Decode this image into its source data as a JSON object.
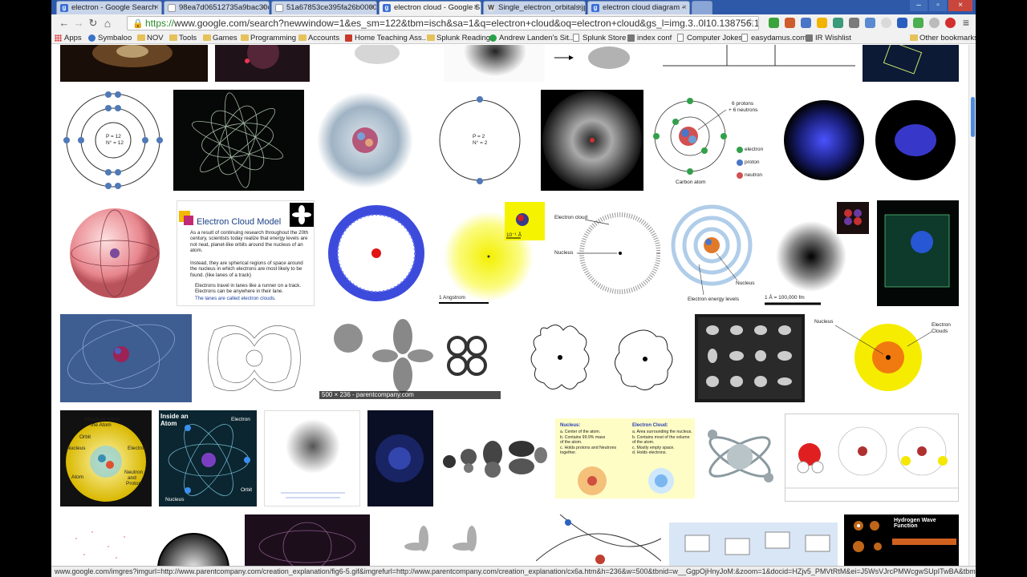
{
  "tabs": [
    {
      "label": "electron - Google Search",
      "icon": "google-icon"
    },
    {
      "label": "98ea7d06512735a9bac30c",
      "icon": "document-icon"
    },
    {
      "label": "51a67853ce395fa26b00000",
      "icon": "document-icon"
    },
    {
      "label": "electron cloud - Google S",
      "icon": "google-icon",
      "active": true
    },
    {
      "label": "Single_electron_orbitals.jp",
      "icon": "wikipedia-icon"
    },
    {
      "label": "electron cloud diagram -",
      "icon": "google-icon"
    }
  ],
  "toolbar": {
    "url_scheme": "https://",
    "url_rest": "www.google.com/search?newwindow=1&es_sm=122&tbm=isch&sa=1&q=electron+cloud&oq=electron+cloud&gs_l=img.3..0l10.138756.139398.0.141"
  },
  "bookmarks": [
    {
      "label": "Apps",
      "icon": "apps-grid-icon"
    },
    {
      "label": "Symbaloo",
      "icon": "symbaloo-icon"
    },
    {
      "label": "NOV",
      "icon": "folder-icon"
    },
    {
      "label": "Tools",
      "icon": "folder-icon"
    },
    {
      "label": "Games",
      "icon": "folder-icon"
    },
    {
      "label": "Programming",
      "icon": "folder-icon"
    },
    {
      "label": "Accounts",
      "icon": "folder-icon"
    },
    {
      "label": "Home Teaching Ass...",
      "icon": "acrobat-icon"
    },
    {
      "label": "Splunk Reading",
      "icon": "folder-icon"
    },
    {
      "label": "Andrew Landen's Sit...",
      "icon": "green-circle-icon"
    },
    {
      "label": "Splunk Store",
      "icon": "document-icon"
    },
    {
      "label": "index conf",
      "icon": "gray-icon"
    },
    {
      "label": "Computer Jokes",
      "icon": "document-icon"
    },
    {
      "label": "easydamus.com",
      "icon": "document-icon"
    },
    {
      "label": "IR Wishlist",
      "icon": "wishlist-icon"
    },
    {
      "label": "Other bookmarks",
      "icon": "folder-icon"
    }
  ],
  "thumbs_text": {
    "carbon_labels": [
      "6 protons",
      "+ 6 neutrons",
      "electron",
      "proton",
      "neutron",
      "Carbon atom"
    ],
    "bohr_labels": [
      "P = 12",
      "N° = 12",
      "P = 2",
      "N° = 2"
    ],
    "ecm_title": "Electron Cloud Model",
    "ecm_bullets": [
      "As a result of continuing research throughout the 20th century, scientists today realize that energy levels are not neat, planet-like orbits around the nucleus of an atom.",
      "Instead, they are spherical regions of space around the nucleus in which electrons are most likely to be found. (like lanes of a track)",
      "Electrons travel in lanes like a runner on a track. Electrons can be anywhere in their lane.",
      "The lanes are called electron clouds."
    ],
    "angstrom": "1 Angstrom",
    "ten_a": "10⁻¹ Å",
    "cloud_nucleus": [
      "Electron cloud",
      "Nucleus"
    ],
    "energy_levels": [
      "Nucleus",
      "Electron energy levels"
    ],
    "fm": "1 Å = 100,000 fm",
    "parentcompany": "500 × 236 - parentcompany.com",
    "nucleus_clouds": [
      "Nucleus",
      "Electron",
      "Clouds"
    ],
    "inside_atom": [
      "Inside an",
      "Atom",
      "Electron",
      "Orbit",
      "Nucleus"
    ],
    "structure": [
      "Structure within",
      "the Atom",
      "Orbit",
      "Nucleus",
      "Electron",
      "Atom",
      "Neutron",
      "and",
      "Proton"
    ],
    "yellow_table": {
      "left_title": "Nucleus:",
      "left": [
        "a. Center of the atom.",
        "b. Contains 99.9% mass",
        "   of the atom.",
        "c. Holds protons and Neutrons",
        "   together."
      ],
      "right_title": "Electron Cloud:",
      "right": [
        "a. Area surrounding the nucleus.",
        "b. Contains most of the volume",
        "   of the atom.",
        "c. Mostly empty space.",
        "d. Holds electrons."
      ]
    },
    "hydrogen": "Hydrogen Wave Function"
  },
  "status_url": "www.google.com/imgres?imgurl=http://www.parentcompany.com/creation_explanation/fig6-5.gif&imgrefurl=http://www.parentcompany.com/creation_explanation/cx6a.htm&h=236&w=500&tbnid=w__GgpOjHnyJoM:&zoom=1&docid=HZjv5_PMVtRtM&ei=J5WsVJrcPMWcgwSUpITwBA&tbm=isch&ved...",
  "colors": {
    "tabstrip": "#2d59a8",
    "active_tab": "#f1f1f1",
    "accent_blue": "#4a8ce0"
  }
}
